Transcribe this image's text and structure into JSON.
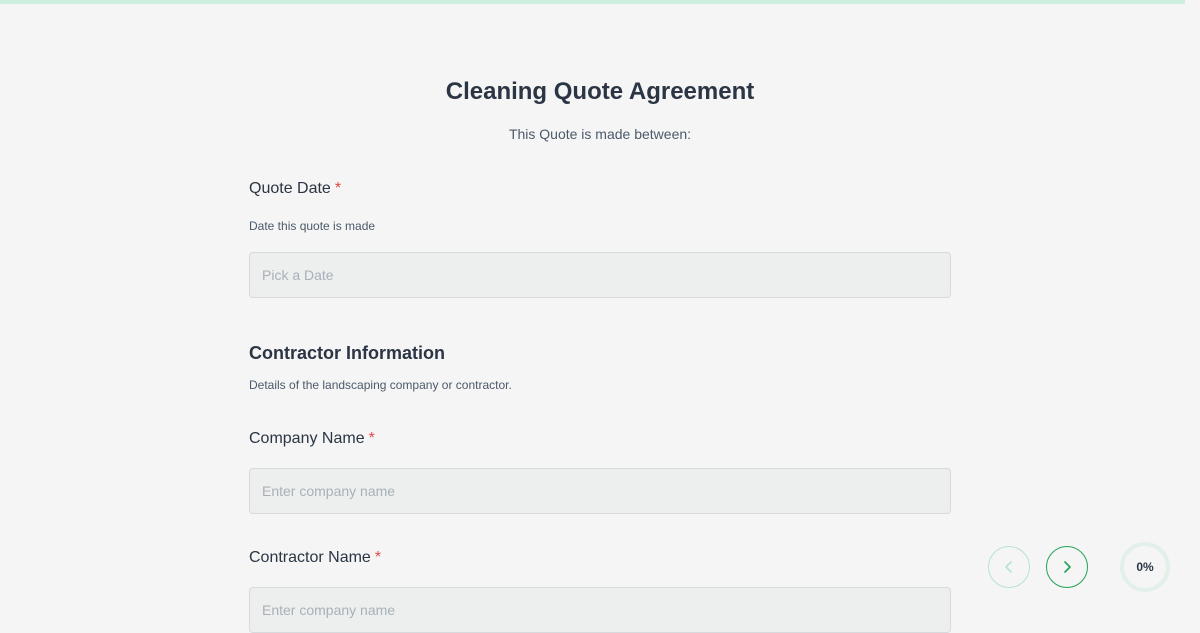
{
  "form": {
    "title": "Cleaning Quote Agreement",
    "subtitle": "This Quote is made between:",
    "quote_date": {
      "label": "Quote Date",
      "required_mark": "*",
      "help": "Date this quote is made",
      "placeholder": "Pick a Date"
    },
    "contractor_section": {
      "title": "Contractor Information",
      "help": "Details of the landscaping company or contractor."
    },
    "company_name": {
      "label": "Company Name",
      "required_mark": "*",
      "placeholder": "Enter company name"
    },
    "contractor_name": {
      "label": "Contractor Name",
      "required_mark": "*",
      "placeholder": "Enter company name"
    }
  },
  "navigation": {
    "prev_icon": "chevron-left-icon",
    "next_icon": "chevron-right-icon",
    "progress_label": "0%",
    "progress_value": 0
  },
  "colors": {
    "accent": "#22a35a",
    "accent_light": "#b6e4cc",
    "required": "#e5484d",
    "top_bar": "#cdeedd"
  }
}
